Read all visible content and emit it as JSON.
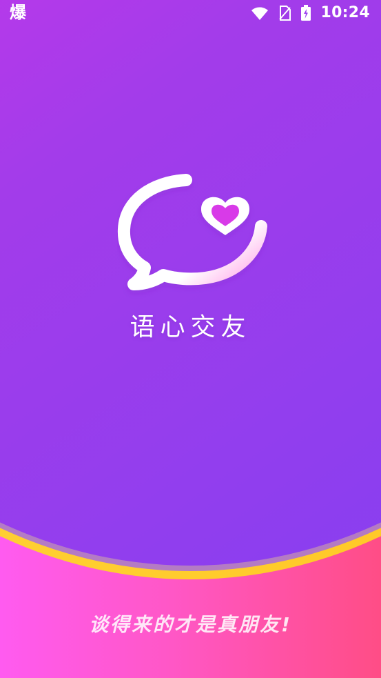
{
  "status_bar": {
    "left_icon_text": "爆",
    "time": "10:24"
  },
  "app": {
    "name": "语心交友",
    "slogan": "谈得来的才是真朋友!"
  },
  "icons": {
    "wifi": "wifi-icon",
    "no_sim": "no-sim-icon",
    "battery": "battery-charging-icon",
    "logo": "chat-heart-logo-icon"
  },
  "colors": {
    "background_top": "#ff3ff0",
    "background_purple": "#8c43f3",
    "bottom_pink": "#ff57c6",
    "bottom_red": "#ff4d86",
    "yellow_arc": "#ffc31f",
    "white": "#ffffff"
  }
}
